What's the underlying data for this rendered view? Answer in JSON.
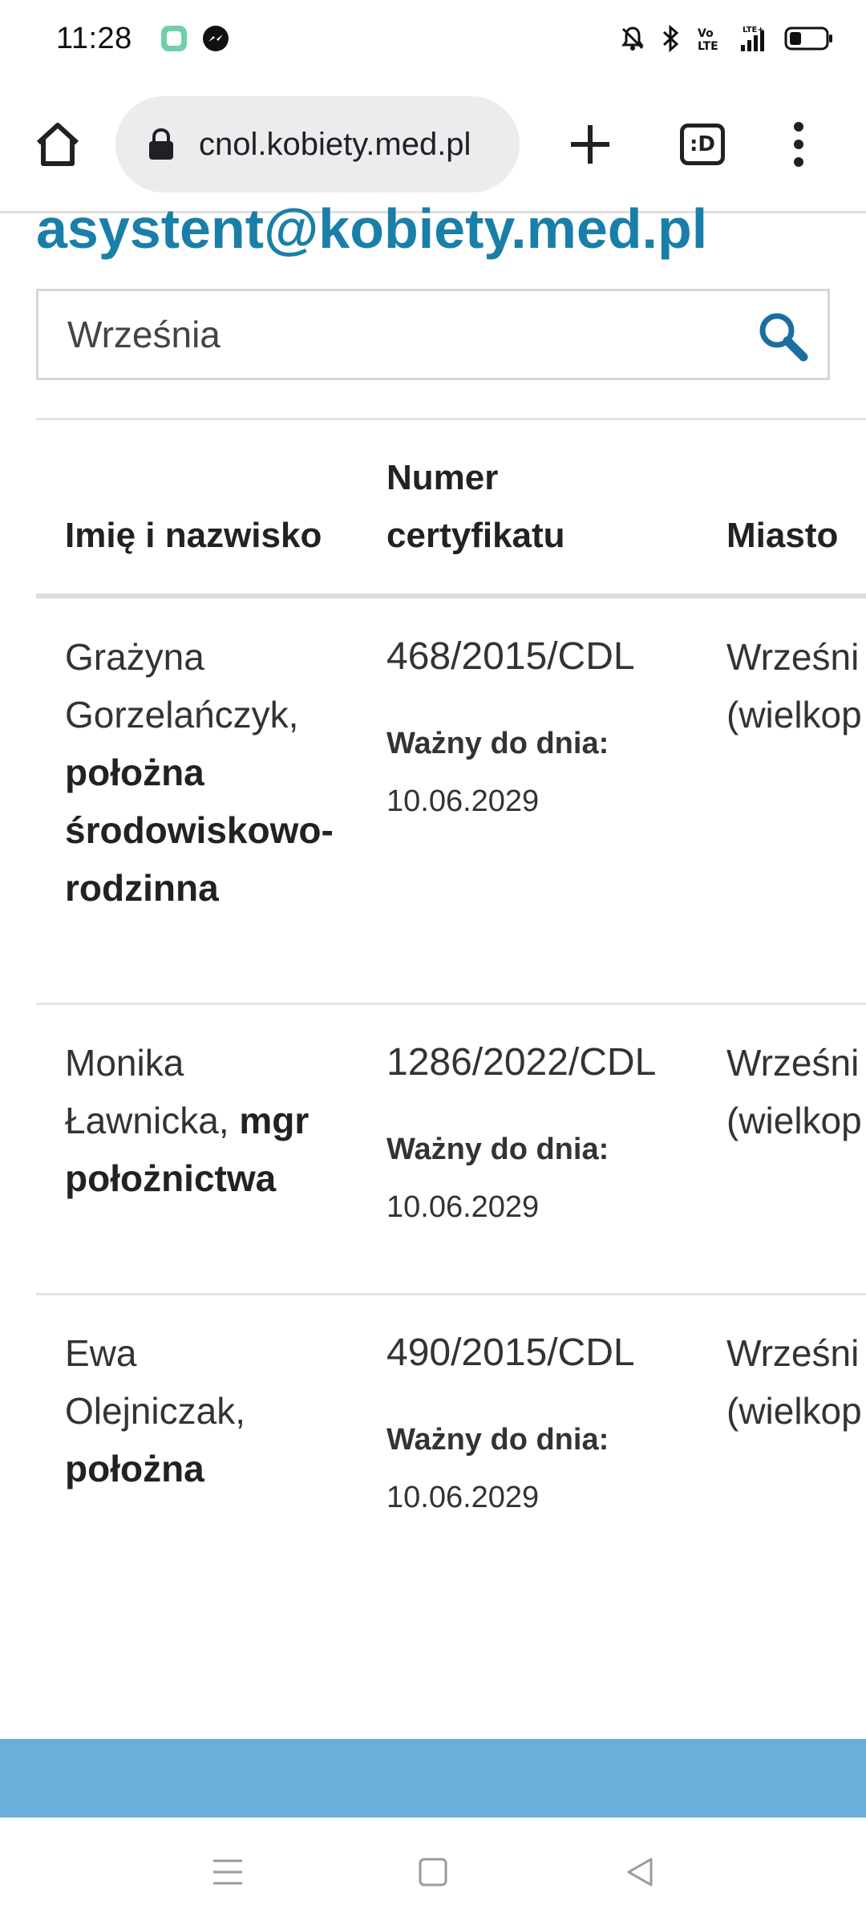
{
  "status_bar": {
    "time": "11:28",
    "icons": [
      "app-square-icon",
      "messenger-icon",
      "mute-icon",
      "bluetooth-icon",
      "volte-icon",
      "signal-icon",
      "battery-icon"
    ]
  },
  "browser": {
    "url": "cnol.kobiety.med.pl",
    "tabs_label": ":D"
  },
  "page": {
    "heading": "asystent@kobiety.med.pl",
    "search": {
      "value": "Września"
    },
    "table": {
      "headers": {
        "name": "Imię i nazwisko",
        "cert_line1": "Numer",
        "cert_line2": "certyfikatu",
        "city": "Miasto"
      },
      "rows": [
        {
          "name": "Grażyna Gorzelańczyk,",
          "title": "położna środowiskowo-rodzinna",
          "cert_number": "468/2015/CDL",
          "valid_label": "Ważny do dnia:",
          "valid_date": "10.06.2029",
          "city_line1": "Wrześni",
          "city_line2": "(wielkop"
        },
        {
          "name": "Monika Ławnicka,",
          "title": "mgr położnictwa",
          "cert_number": "1286/2022/CDL",
          "valid_label": "Ważny do dnia:",
          "valid_date": "10.06.2029",
          "city_line1": "Wrześni",
          "city_line2": "(wielkop"
        },
        {
          "name": "Ewa Olejniczak,",
          "title": "położna",
          "cert_number": "490/2015/CDL",
          "valid_label": "Ważny do dnia:",
          "valid_date": "10.06.2029",
          "city_line1": "Wrześni",
          "city_line2": "(wielkop"
        }
      ]
    }
  },
  "colors": {
    "heading": "#1a7fa8",
    "footer_band": "#6aaedb",
    "search_icon": "#1a6fa0"
  }
}
